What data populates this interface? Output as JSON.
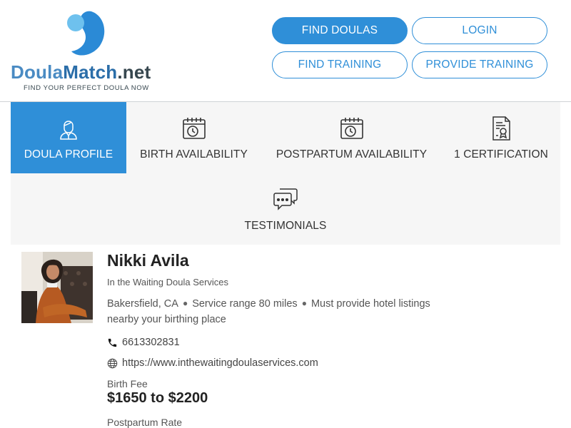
{
  "logo": {
    "doula": "Doula",
    "match": "Match",
    "net": ".net",
    "tagline": "FIND YOUR PERFECT DOULA NOW"
  },
  "nav": {
    "find_doulas": "FIND DOULAS",
    "login": "LOGIN",
    "find_training": "FIND TRAINING",
    "provide_training": "PROVIDE TRAINING"
  },
  "tabs": [
    {
      "label": "DOULA PROFILE",
      "icon": "doula-person-icon",
      "active": true
    },
    {
      "label": "BIRTH AVAILABILITY",
      "icon": "calendar-clock-icon",
      "active": false
    },
    {
      "label": "POSTPARTUM AVAILABILITY",
      "icon": "calendar-clock-icon",
      "active": false
    },
    {
      "label": "1 CERTIFICATION",
      "icon": "certificate-icon",
      "active": false
    },
    {
      "label": "TESTIMONIALS",
      "icon": "chat-bubbles-icon",
      "active": false
    }
  ],
  "profile": {
    "name": "Nikki Avila",
    "business": "In the Waiting Doula Services",
    "location": "Bakersfield, CA",
    "service_range": "Service range 80 miles",
    "hotel_note_1": "Must provide hotel listings",
    "hotel_note_2": "nearby your birthing place",
    "phone": "6613302831",
    "website": "https://www.inthewaitingdoulaservices.com",
    "birth_fee_label": "Birth Fee",
    "birth_fee_value": "$1650 to $2200",
    "postpartum_label": "Postpartum Rate"
  },
  "colors": {
    "accent": "#2f8fd8",
    "logo_light_blue": "#6ec1ee",
    "logo_dark_blue": "#2b8ad6"
  }
}
